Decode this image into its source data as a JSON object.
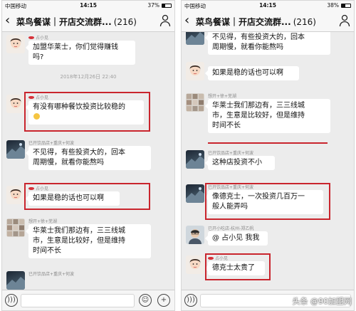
{
  "status_bar": {
    "left_phone": {
      "carrier": "中国移动",
      "time": "14:15",
      "battery": "37%",
      "battery_level": 0.37
    },
    "right_phone": {
      "carrier": "中国移动",
      "time": "14:15",
      "battery": "38%",
      "battery_level": 0.38
    }
  },
  "chat_header": {
    "title": "菜鸟餐谋｜开店交流群...",
    "member_count": "(216)"
  },
  "left_chat": {
    "msg1": {
      "sender": "占小见",
      "text_line1": "加盟华莱士，你们觉得赚钱",
      "text_line2": "吗?"
    },
    "timestamp": "2018年12月26日 22:40",
    "msg2": {
      "sender": "占小见",
      "text_line1": "有没有哪种餐饮投资比较稳的"
    },
    "msg3": {
      "sender": "已开饮品店+重庆+何波",
      "text_line1": "不见得，有些投资大的，回本",
      "text_line2": "周期慢，就看你能熬吗"
    },
    "msg4": {
      "sender": "占小见",
      "text_line1": "如果是稳的话也可以啊"
    },
    "msg5": {
      "sender": "想开+徐+芜湖",
      "text_line1": "华莱士我们那边有，三三线城",
      "text_line2": "市，生意是比较好，但是维持",
      "text_line3": "时间不长"
    },
    "msg6": {
      "sender": "已开饮品店+重庆+何波"
    }
  },
  "right_chat": {
    "msg1": {
      "text_line1": "不见得，有些投资大的，回本",
      "text_line2": "周期慢，就看你能熬吗"
    },
    "msg2": {
      "text_line1": "如果是稳的话也可以啊"
    },
    "msg3": {
      "sender": "想开+徐+芜湖",
      "text_line1": "华莱士我们那边有，三三线城",
      "text_line2": "市，生意是比较好，但是维持",
      "text_line3": "时间不长"
    },
    "msg4": {
      "sender": "已开饮品店+重庆+何波",
      "text_line1": "这种店投资不小"
    },
    "msg5": {
      "sender": "已开饮品店+重庆+何波",
      "text_line1": "像德克士，一次投资几百万一",
      "text_line2": "般人能弄吗"
    },
    "msg6": {
      "sender": "已开小吃店-杭州-郑乙帆",
      "text_line1": "@ 占小见 我我"
    },
    "msg7": {
      "sender": "占小见",
      "text_line1": "德克士太贵了"
    }
  },
  "watermark": "头条 @90加盟网",
  "icons": {
    "voice": "voice-icon",
    "emoji": "emoji-icon",
    "plus": "plus-icon",
    "back": "back-chevron-icon",
    "group": "group-info-icon"
  },
  "colors": {
    "highlight": "#c9252d",
    "chat_bg": "#ececec",
    "bubble": "#ffffff"
  }
}
